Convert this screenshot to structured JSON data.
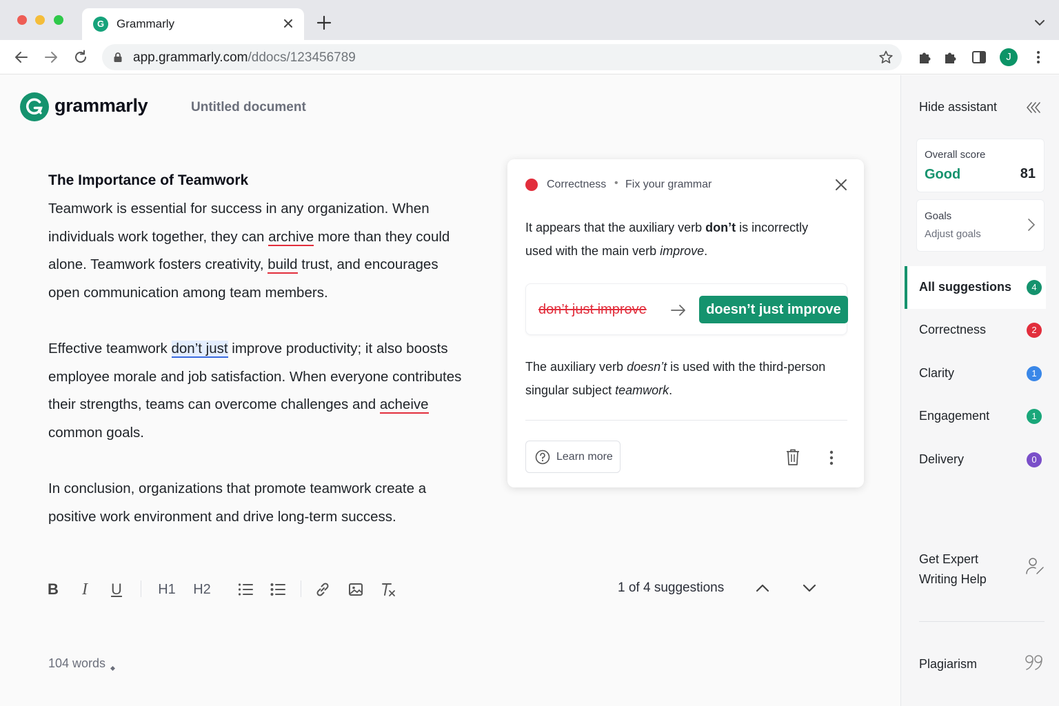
{
  "browser": {
    "tab_title": "Grammarly",
    "url_host": "app.grammarly.com",
    "url_path": "/ddocs/123456789",
    "profile_initial": "J"
  },
  "app": {
    "wordmark": "grammarly",
    "favicon_letter": "G",
    "doc_title": "Untitled document",
    "brand_color": "#15936e"
  },
  "document": {
    "heading": "The Importance of Teamwork",
    "p1": {
      "t1": "Teamwork is essential for success in any organization. When individuals work together, they can ",
      "e1": "archive",
      "t2": " more than they could alone. Teamwork fosters creativity, ",
      "e2": "build",
      "t3": " trust, and encourages open communication among team members."
    },
    "p2": {
      "t1": "Effective teamwork ",
      "h1": "don’t just",
      "t2": " improve productivity; it also boosts employee morale and job satisfaction. When everyone contributes their strengths, teams can overcome challenges and ",
      "e1": "acheive",
      "t3": " common goals."
    },
    "p3": "In conclusion, organizations that promote teamwork create a positive work environment and drive long-term success.",
    "word_count": "104 words"
  },
  "formatting_toolbar": {
    "bold": "B",
    "italic": "I",
    "underline": "U",
    "h1": "H1",
    "h2": "H2",
    "icons": [
      "bold-icon",
      "italic-icon",
      "underline-icon",
      "heading-1-icon",
      "heading-2-icon",
      "numbered-list-icon",
      "bulleted-list-icon",
      "link-icon",
      "image-icon",
      "clear-formatting-icon"
    ]
  },
  "suggestion_nav": {
    "label": "1 of 4 suggestions"
  },
  "suggestion_card": {
    "category": "Correctness",
    "separator": "•",
    "subtitle": "Fix your grammar",
    "explain1": {
      "a": "It appears that the auxiliary verb ",
      "b": "don’t",
      "c": " is incorrectly used with the main verb ",
      "d": "improve",
      "e": "."
    },
    "old_text": "don’t just improve",
    "new_text": "doesn’t just improve",
    "explain2": {
      "a": "The auxiliary verb ",
      "b": "doesn’t",
      "c": " is used with the third-person singular subject ",
      "d": "teamwork",
      "e": "."
    },
    "learn_more": "Learn more",
    "error_color": "#e22e3c"
  },
  "sidebar": {
    "hide_assistant": "Hide assistant",
    "overall_score_label": "Overall score",
    "overall_score_word": "Good",
    "overall_score_value": "81",
    "goals_label": "Goals",
    "goals_sub": "Adjust goals",
    "categories": [
      {
        "label": "All suggestions",
        "count": "4",
        "color": "#15936e"
      },
      {
        "label": "Correctness",
        "count": "2",
        "color": "#e22e3c"
      },
      {
        "label": "Clarity",
        "count": "1",
        "color": "#3a87e8"
      },
      {
        "label": "Engagement",
        "count": "1",
        "color": "#1aa77a"
      },
      {
        "label": "Delivery",
        "count": "0",
        "color": "#7a4fc9"
      }
    ],
    "expert_help": "Get Expert Writing Help",
    "plagiarism": "Plagiarism"
  }
}
